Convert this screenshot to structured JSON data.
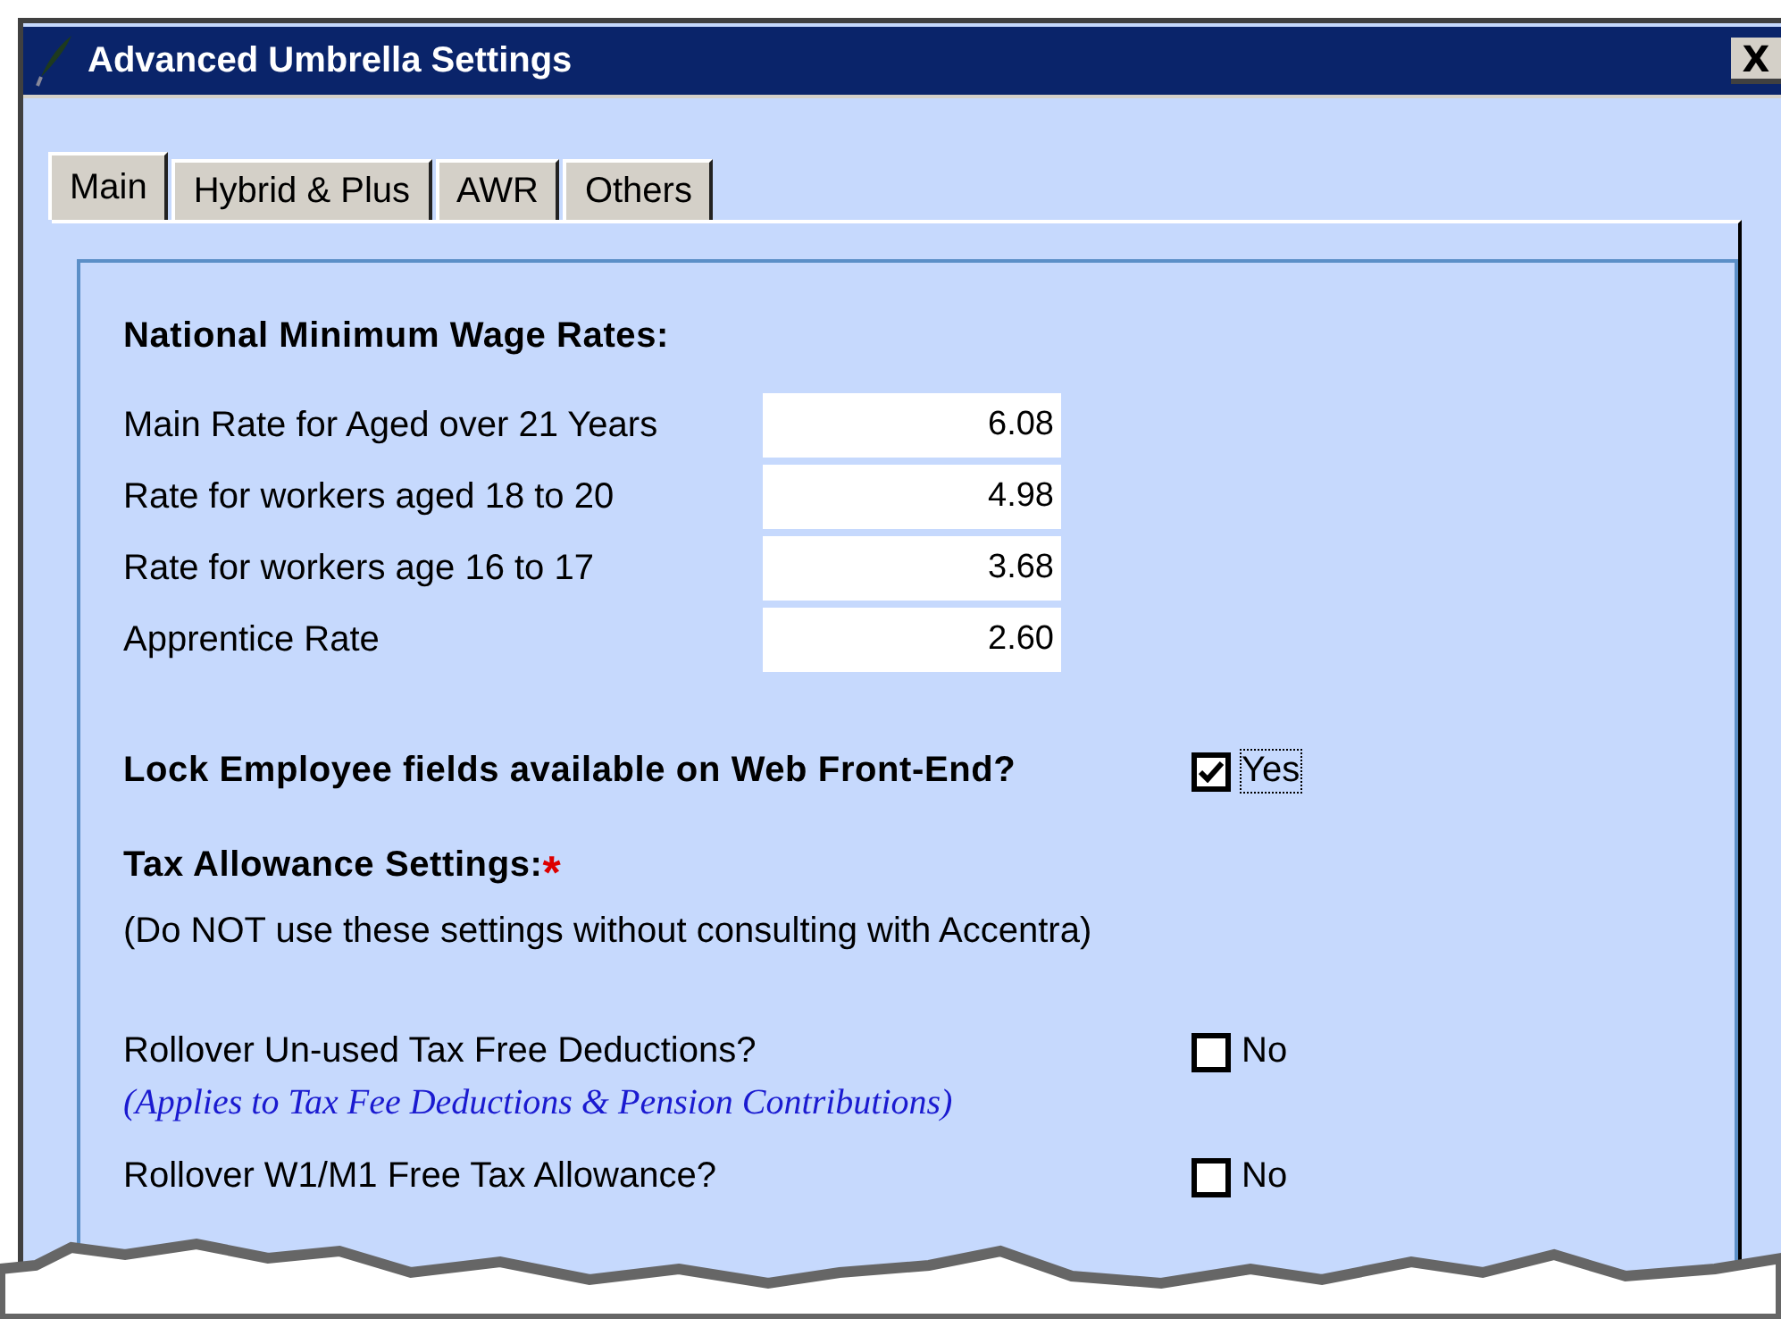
{
  "window": {
    "title": "Advanced Umbrella Settings",
    "close": "X"
  },
  "tabs": [
    {
      "label": "Main",
      "selected": true
    },
    {
      "label": "Hybrid & Plus",
      "selected": false
    },
    {
      "label": "AWR",
      "selected": false
    },
    {
      "label": "Others",
      "selected": false
    }
  ],
  "wage_rates": {
    "heading": "National Minimum Wage Rates:",
    "rows": [
      {
        "label": "Main Rate for Aged over 21 Years",
        "value": "6.08"
      },
      {
        "label": "Rate for workers aged 18 to 20",
        "value": "4.98"
      },
      {
        "label": "Rate for workers age 16 to 17",
        "value": "3.68"
      },
      {
        "label": "Apprentice Rate",
        "value": "2.60"
      }
    ]
  },
  "lock_fields": {
    "label": "Lock Employee fields available on Web Front-End?",
    "checked": true,
    "option": "Yes"
  },
  "tax_allowance": {
    "heading": "Tax Allowance Settings:",
    "required_mark": "*",
    "warning": "(Do NOT use these settings without consulting with Accentra)",
    "options": [
      {
        "label": "Rollover Un-used Tax Free Deductions?",
        "checked": false,
        "option": "No",
        "note": "(Applies to Tax Fee Deductions & Pension Contributions)"
      },
      {
        "label": "Rollover W1/M1 Free Tax Allowance?",
        "checked": false,
        "option": "No"
      }
    ]
  }
}
